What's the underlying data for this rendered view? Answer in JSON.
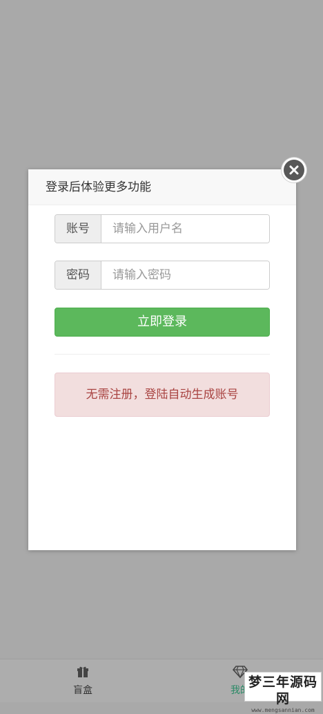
{
  "bottom_nav": {
    "items": [
      {
        "label": "盲盒",
        "icon": "gift-icon"
      },
      {
        "label": "我的",
        "icon": "diamond-icon"
      }
    ]
  },
  "watermark": {
    "title": "梦三年源码网",
    "url": "www.mengsannian.com"
  },
  "modal": {
    "title": "登录后体验更多功能",
    "username": {
      "addon": "账号",
      "placeholder": "请输入用户名"
    },
    "password": {
      "addon": "密码",
      "placeholder": "请输入密码"
    },
    "login_label": "立即登录",
    "notice": "无需注册，登陆自动生成账号"
  },
  "colors": {
    "overlay_gray": "#a9a9a9",
    "button_green": "#5cb85c",
    "alert_bg": "#f2dede",
    "alert_text": "#a94442",
    "nav_active": "#2a8a66"
  }
}
